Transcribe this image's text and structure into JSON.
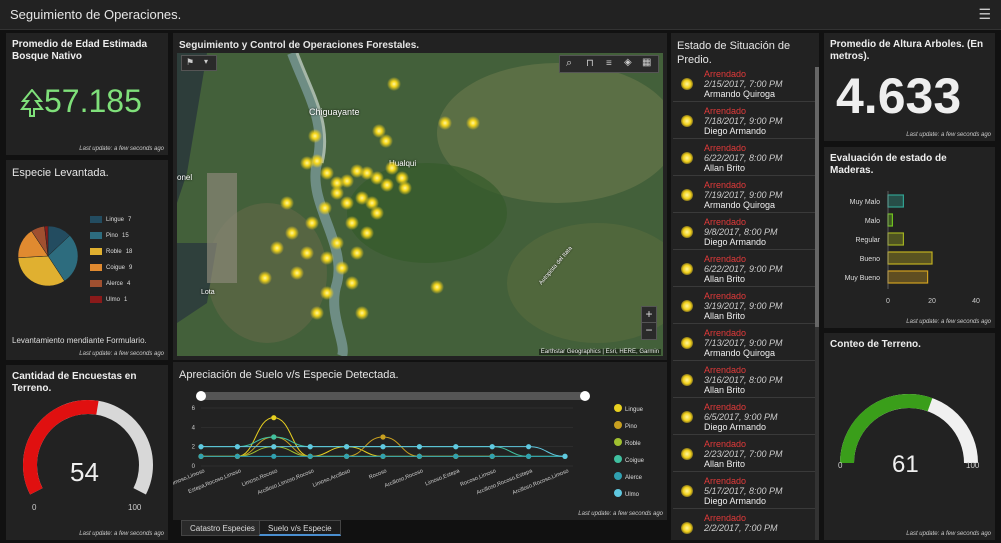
{
  "header": {
    "title": "Seguimiento de Operaciones.",
    "menu_icon": "hamburger-icon"
  },
  "edad": {
    "title": "Promedio de Edad Estimada Bosque Nativo",
    "value": "57.185",
    "icon": "tree-icon",
    "color": "#7fe07a",
    "updated": "Last update: a few seconds ago"
  },
  "especie": {
    "title": "Especie Levantada.",
    "footer": "Levantamiento mendiante Formulario.",
    "updated": "Last update: a few seconds ago",
    "legend": [
      {
        "label": "Lingue",
        "value": "7"
      },
      {
        "label": "Pino",
        "value": "15"
      },
      {
        "label": "Roble",
        "value": "18"
      },
      {
        "label": "Coigue",
        "value": "9"
      },
      {
        "label": "Alerce",
        "value": "4"
      },
      {
        "label": "Ulmo",
        "value": "1"
      }
    ]
  },
  "encuestas": {
    "title": "Cantidad de Encuestas en Terreno.",
    "value": "54",
    "min": "0",
    "max": "100",
    "fraction": 0.54,
    "color": "#e01010",
    "updated": "Last update: a few seconds ago"
  },
  "map": {
    "title": "Seguimiento y Control de Operaciones Forestales.",
    "labels": {
      "chiguayante": "Chiguayante",
      "hualqui": "Hualqui",
      "onel": "onel",
      "lota": "Lota",
      "road": "Autopista del Itata"
    },
    "attribution": "Earthstar Geographics | Esri, HERE, Garmin",
    "zoom_in": "+",
    "zoom_out": "−"
  },
  "suelo": {
    "title": "Apreciación de Suelo v/s Especie Detectada.",
    "updated": "Last update: a few seconds ago",
    "categories": [
      "Limoso,Limoso",
      "Estepa,Rocoso,Limoso",
      "Limoso,Rocoso",
      "Arcilloso,Limoso,Rocoso",
      "Limoso,Arcilloso",
      "Rocoso",
      "Arcilloso,Rocoso",
      "Limoso,Estepa",
      "Rocoso,Limoso",
      "Arcilloso,Rocoso,Estepa",
      "Arcilloso,Rocoso,Limoso"
    ],
    "ytick_labels": [
      "0",
      "2",
      "4",
      "6"
    ]
  },
  "chart_data": {
    "type": "line",
    "categories": [
      "Limoso,Limoso",
      "Estepa,Rocoso,Limoso",
      "Limoso,Rocoso",
      "Arcilloso,Limoso,Rocoso",
      "Limoso,Arcilloso",
      "Rocoso",
      "Arcilloso,Rocoso",
      "Limoso,Estepa",
      "Rocoso,Limoso",
      "Arcilloso,Rocoso,Estepa",
      "Arcilloso,Rocoso,Limoso"
    ],
    "ylim": [
      0,
      6
    ],
    "series": [
      {
        "name": "Lingue",
        "color": "#e8d020",
        "values": [
          1,
          1,
          5,
          1,
          2,
          1,
          1,
          1,
          1,
          0,
          0
        ]
      },
      {
        "name": "Pino",
        "color": "#c8a020",
        "values": [
          1,
          1,
          3,
          1,
          1,
          3,
          1,
          1,
          1,
          0,
          0
        ]
      },
      {
        "name": "Roble",
        "color": "#a0c030",
        "values": [
          1,
          1,
          2,
          1,
          1,
          1,
          1,
          1,
          1,
          1,
          1
        ]
      },
      {
        "name": "Coigue",
        "color": "#40c0a0",
        "values": [
          2,
          2,
          3,
          2,
          2,
          2,
          2,
          2,
          2,
          1,
          1
        ]
      },
      {
        "name": "Alerce",
        "color": "#30a0b0",
        "values": [
          1,
          1,
          1,
          1,
          1,
          1,
          1,
          1,
          1,
          1,
          1
        ]
      },
      {
        "name": "Ulmo",
        "color": "#60c8e0",
        "values": [
          2,
          2,
          2,
          2,
          2,
          2,
          2,
          2,
          2,
          2,
          1
        ]
      }
    ]
  },
  "tabs": [
    {
      "label": "Catastro Especies"
    },
    {
      "label": "Suelo v/s Especie"
    }
  ],
  "estado": {
    "title": "Estado de Situación de Predio.",
    "items": [
      {
        "status": "Arrendado",
        "date": "2/15/2017, 7:00 PM",
        "name": "Armando Quiroga"
      },
      {
        "status": "Arrendado",
        "date": "7/18/2017, 9:00 PM",
        "name": "Diego Armando"
      },
      {
        "status": "Arrendado",
        "date": "6/22/2017, 8:00 PM",
        "name": "Allan Brito"
      },
      {
        "status": "Arrendado",
        "date": "7/19/2017, 9:00 PM",
        "name": "Armando Quiroga"
      },
      {
        "status": "Arrendado",
        "date": "9/8/2017, 8:00 PM",
        "name": "Diego Armando"
      },
      {
        "status": "Arrendado",
        "date": "6/22/2017, 9:00 PM",
        "name": "Allan Brito"
      },
      {
        "status": "Arrendado",
        "date": "3/19/2017, 9:00 PM",
        "name": "Allan Brito"
      },
      {
        "status": "Arrendado",
        "date": "7/13/2017, 9:00 PM",
        "name": "Armando Quiroga"
      },
      {
        "status": "Arrendado",
        "date": "3/16/2017, 8:00 PM",
        "name": "Allan Brito"
      },
      {
        "status": "Arrendado",
        "date": "6/5/2017, 9:00 PM",
        "name": "Diego Armando"
      },
      {
        "status": "Arrendado",
        "date": "2/23/2017, 7:00 PM",
        "name": "Allan Brito"
      },
      {
        "status": "Arrendado",
        "date": "5/17/2017, 8:00 PM",
        "name": "Diego Armando"
      },
      {
        "status": "Arrendado",
        "date": "2/2/2017, 7:00 PM",
        "name": ""
      }
    ]
  },
  "altura": {
    "title": "Promedio de Altura Arboles. (En metros).",
    "value": "4.633",
    "updated": "Last update: a few seconds ago"
  },
  "evaluacion": {
    "title": "Evaluación de estado de Maderas.",
    "updated": "Last update: a few seconds ago",
    "xticks": [
      "0",
      "20",
      "40"
    ],
    "bars": [
      {
        "label": "Muy Malo",
        "value": 7,
        "color": "#30a090"
      },
      {
        "label": "Malo",
        "value": 2,
        "color": "#70c020"
      },
      {
        "label": "Regular",
        "value": 7,
        "color": "#a0b020"
      },
      {
        "label": "Bueno",
        "value": 20,
        "color": "#c0b020"
      },
      {
        "label": "Muy Bueno",
        "value": 18,
        "color": "#d0a020"
      }
    ],
    "xmax": 40
  },
  "conteo": {
    "title": "Conteo de Terreno.",
    "value": "61",
    "min": "0",
    "max": "100",
    "fraction": 0.61,
    "color": "#3a9e1a",
    "updated": "Last update: a few seconds ago"
  }
}
